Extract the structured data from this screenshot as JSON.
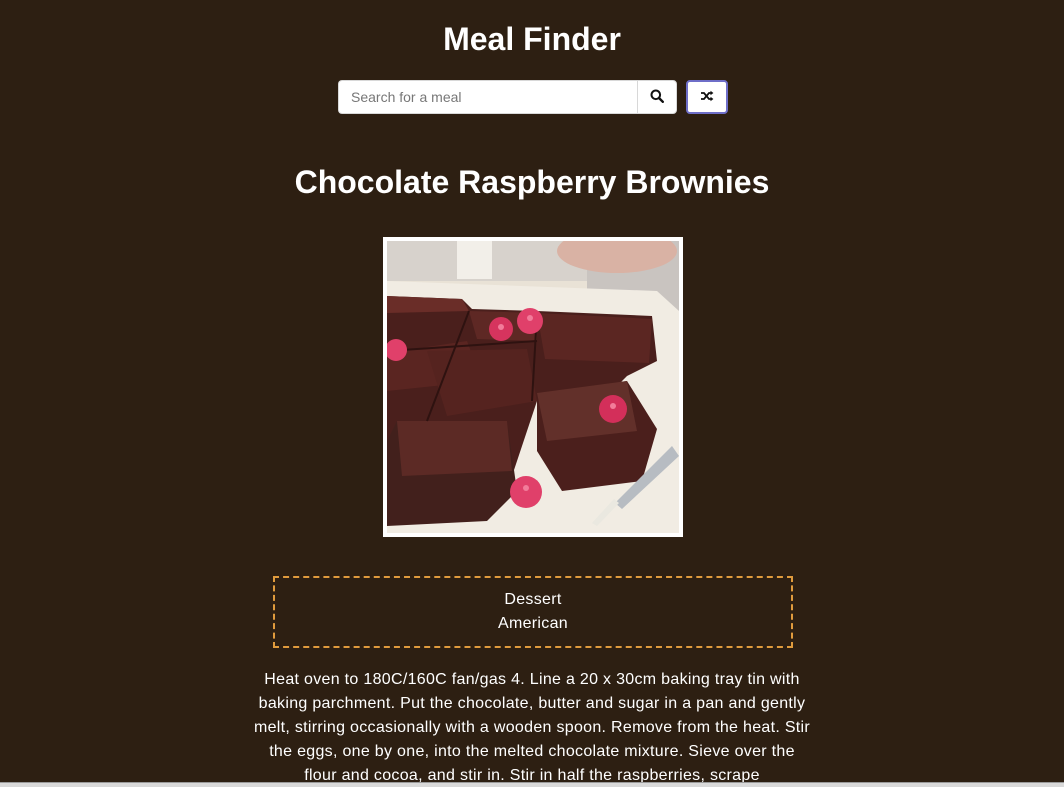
{
  "header": {
    "title": "Meal Finder"
  },
  "search": {
    "placeholder": "Search for a meal",
    "value": "",
    "search_icon": "search-icon",
    "random_icon": "shuffle-icon"
  },
  "meal": {
    "title": "Chocolate Raspberry Brownies",
    "category": "Dessert",
    "area": "American",
    "instructions": "Heat oven to 180C/160C fan/gas 4. Line a 20 x 30cm baking tray tin with baking parchment. Put the chocolate, butter and sugar in a pan and gently melt, stirring occasionally with a wooden spoon. Remove from the heat. Stir the eggs, one by one, into the melted chocolate mixture. Sieve over the flour and cocoa, and stir in. Stir in half the raspberries, scrape"
  },
  "colors": {
    "background": "#2d1f12",
    "text": "#ffffff",
    "info_border": "#e09b3d",
    "random_button_border": "#6e6ec8"
  }
}
